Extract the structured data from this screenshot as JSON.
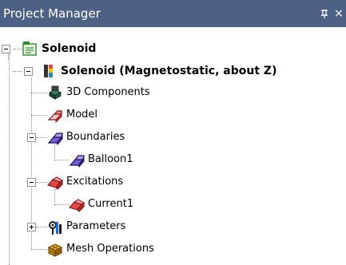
{
  "panel": {
    "title": "Project Manager",
    "pin_glyph": "4",
    "close_glyph": "×"
  },
  "tree": {
    "project": {
      "label": "Solenoid",
      "icon": "project-icon",
      "expanded": true
    },
    "design": {
      "label": "Solenoid (Magnetostatic, about Z)",
      "icon": "design-icon",
      "expanded": true
    },
    "items": [
      {
        "label": "3D Components",
        "icon": "3d-components-icon"
      },
      {
        "label": "Model",
        "icon": "model-icon"
      },
      {
        "label": "Boundaries",
        "icon": "boundaries-icon",
        "expanded": true,
        "children": [
          {
            "label": "Balloon1",
            "icon": "balloon-icon"
          }
        ]
      },
      {
        "label": "Excitations",
        "icon": "excitations-icon",
        "expanded": true,
        "children": [
          {
            "label": "Current1",
            "icon": "current-icon"
          }
        ]
      },
      {
        "label": "Parameters",
        "icon": "parameters-icon",
        "expanded": false
      },
      {
        "label": "Mesh Operations",
        "icon": "mesh-operations-icon"
      }
    ]
  },
  "colors": {
    "titlebar": "#4d6185",
    "tree_lines": "#8c8c8c"
  }
}
